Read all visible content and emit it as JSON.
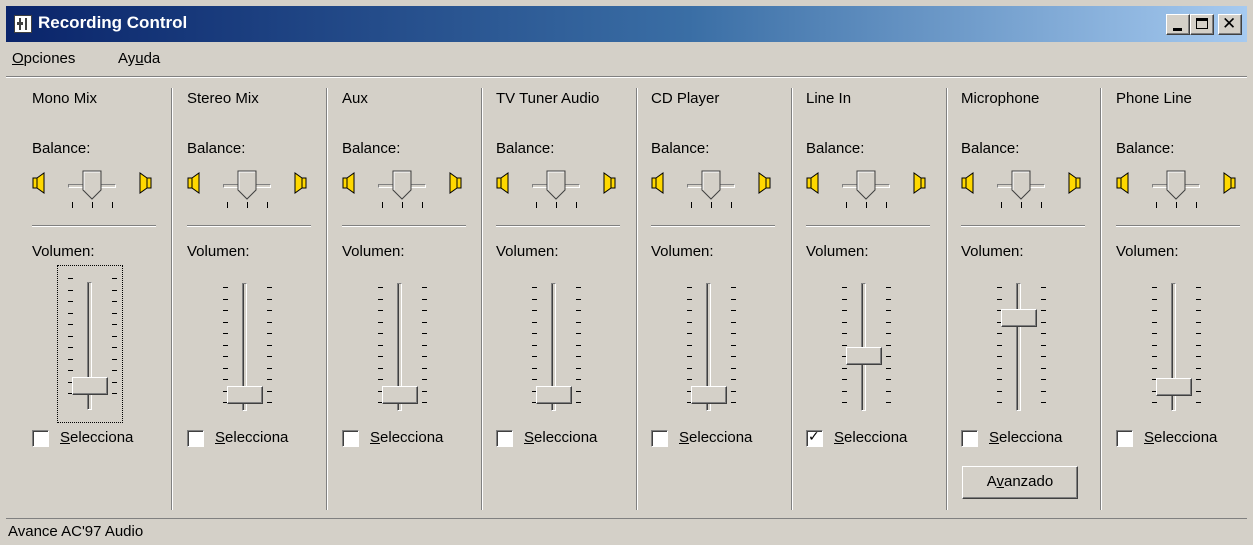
{
  "window": {
    "title": "Recording Control"
  },
  "menu": {
    "items": [
      {
        "label_u": "O",
        "label_rest": "pciones"
      },
      {
        "label_pre": "Ay",
        "label_u": "u",
        "label_rest": "da"
      }
    ]
  },
  "labels": {
    "balance": "Balance:",
    "volume": "Volumen:",
    "select_u": "S",
    "select_rest": "elecciona"
  },
  "channels": [
    {
      "name": "Mono Mix",
      "volume": 0.12,
      "selected": false
    },
    {
      "name": "Stereo Mix",
      "volume": 0.05,
      "selected": false
    },
    {
      "name": "Aux",
      "volume": 0.05,
      "selected": false
    },
    {
      "name": "TV Tuner Audio",
      "volume": 0.05,
      "selected": false
    },
    {
      "name": "CD Player",
      "volume": 0.05,
      "selected": false
    },
    {
      "name": "Line In",
      "volume": 0.4,
      "selected": true
    },
    {
      "name": "Microphone",
      "volume": 0.75,
      "selected": false
    },
    {
      "name": "Phone Line",
      "volume": 0.12,
      "selected": false
    }
  ],
  "advanced_button": {
    "pre": "A",
    "u": "v",
    "rest": "anzado"
  },
  "status": {
    "text": "Avance AC'97 Audio"
  }
}
